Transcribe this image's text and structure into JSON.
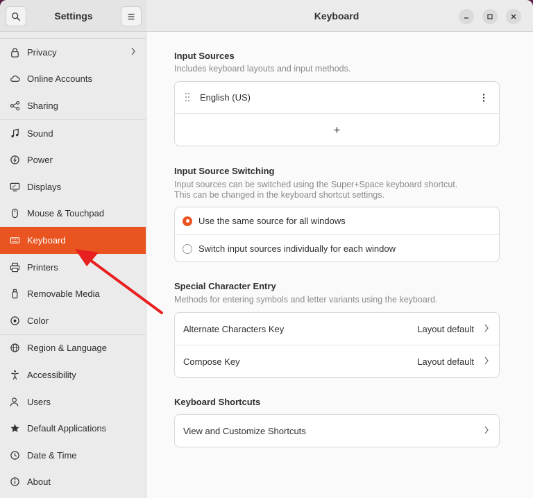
{
  "sidebar": {
    "title": "Settings",
    "items": [
      {
        "label": "Privacy",
        "icon": "lock-icon"
      },
      {
        "label": "Online Accounts",
        "icon": "cloud-icon"
      },
      {
        "label": "Sharing",
        "icon": "share-icon"
      },
      {
        "label": "Sound",
        "icon": "music-note-icon"
      },
      {
        "label": "Power",
        "icon": "power-icon"
      },
      {
        "label": "Displays",
        "icon": "display-icon"
      },
      {
        "label": "Mouse & Touchpad",
        "icon": "mouse-icon"
      },
      {
        "label": "Keyboard",
        "icon": "keyboard-icon",
        "active": true
      },
      {
        "label": "Printers",
        "icon": "printer-icon"
      },
      {
        "label": "Removable Media",
        "icon": "usb-drive-icon"
      },
      {
        "label": "Color",
        "icon": "color-icon"
      },
      {
        "label": "Region & Language",
        "icon": "globe-icon"
      },
      {
        "label": "Accessibility",
        "icon": "accessibility-icon"
      },
      {
        "label": "Users",
        "icon": "users-icon"
      },
      {
        "label": "Default Applications",
        "icon": "star-icon"
      },
      {
        "label": "Date & Time",
        "icon": "clock-icon"
      },
      {
        "label": "About",
        "icon": "info-icon"
      }
    ]
  },
  "header": {
    "title": "Keyboard"
  },
  "input_sources": {
    "title": "Input Sources",
    "subtitle": "Includes keyboard layouts and input methods.",
    "source": "English (US)",
    "add_label": "+"
  },
  "switching": {
    "title": "Input Source Switching",
    "subtitle_line1": "Input sources can be switched using the Super+Space keyboard shortcut.",
    "subtitle_line2": "This can be changed in the keyboard shortcut settings.",
    "options": [
      {
        "label": "Use the same source for all windows",
        "selected": true
      },
      {
        "label": "Switch input sources individually for each window",
        "selected": false
      }
    ]
  },
  "special_chars": {
    "title": "Special Character Entry",
    "subtitle": "Methods for entering symbols and letter variants using the keyboard.",
    "rows": [
      {
        "label": "Alternate Characters Key",
        "value": "Layout default"
      },
      {
        "label": "Compose Key",
        "value": "Layout default"
      }
    ]
  },
  "shortcuts": {
    "title": "Keyboard Shortcuts",
    "row_label": "View and Customize Shortcuts"
  },
  "colors": {
    "accent": "#e95420",
    "annotation_arrow": "#e8201f"
  }
}
